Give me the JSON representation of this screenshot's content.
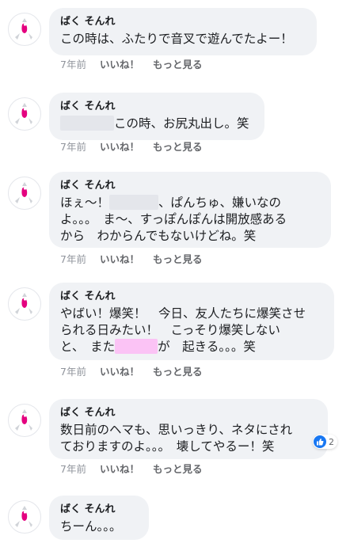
{
  "comments": [
    {
      "author": "ばく そんれ",
      "lines": [
        [
          {
            "t": "この時は、ふたりで音叉で遊んでたよー！"
          }
        ]
      ],
      "time": "7年前",
      "like": "いいね！",
      "more": "もっと見る"
    },
    {
      "author": "ばく そんれ",
      "lines": [
        [
          {
            "redact": "gray"
          },
          {
            "t": "この時、お尻丸出し。笑"
          }
        ]
      ],
      "time": "7年前",
      "like": "いいね！",
      "more": "もっと見る"
    },
    {
      "author": "ばく そんれ",
      "lines": [
        [
          {
            "t": "ほぇ〜！"
          },
          {
            "redact": "gray"
          },
          {
            "t": "、ぱんちゅ、嫌いなの"
          }
        ],
        [
          {
            "t": "よ。。。　ま〜、すっぽんぽんは開放感ある"
          }
        ],
        [
          {
            "t": "から　わからんでもないけどね。笑"
          }
        ]
      ],
      "time": "7年前",
      "like": "いいね！",
      "more": "もっと見る"
    },
    {
      "author": "ばく そんれ",
      "lines": [
        [
          {
            "t": "やばい！爆笑！　今日、友人たちに爆笑させ"
          }
        ],
        [
          {
            "t": "られる日みたい！　こっそり爆笑しない"
          }
        ],
        [
          {
            "t": "と、　また"
          },
          {
            "redact": "pink"
          },
          {
            "t": "が　起きる。。。笑"
          }
        ]
      ],
      "time": "7年前",
      "like": "いいね！",
      "more": "もっと見る"
    },
    {
      "author": "ばく そんれ",
      "lines": [
        [
          {
            "t": "数日前のヘマも、思いっきり、ネタにされ"
          }
        ],
        [
          {
            "t": "ておりますのよ。。。　壊してやるー！笑"
          }
        ]
      ],
      "time": "7年前",
      "like": "いいね！",
      "more": "もっと見る",
      "reaction": {
        "icon": "like-icon",
        "count": "2"
      }
    },
    {
      "author": "ばく そんれ",
      "lines": [
        [
          {
            "t": "ちーん。。。"
          }
        ]
      ]
    }
  ],
  "colors": {
    "bubble": "#f0f2f5",
    "like_blue": "#1877f2",
    "redact_gray": "#e4e6eb",
    "redact_pink": "#fbc3f5",
    "avatar_accent": "#e4007f"
  }
}
